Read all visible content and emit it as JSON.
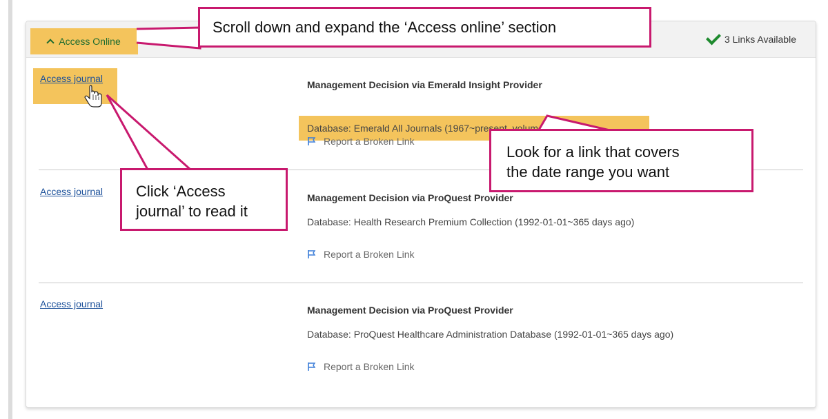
{
  "header": {
    "toggle_label": "Access Online",
    "links_available": "3 Links Available"
  },
  "links": [
    {
      "access_label": "Access journal",
      "provider": "Management Decision via Emerald Insight Provider",
      "database": "Database: Emerald All Journals (1967~present, volume:1;issue:1)",
      "report_label": "Report a Broken Link"
    },
    {
      "access_label": "Access journal",
      "provider": "Management Decision via ProQuest Provider",
      "database": "Database: Health Research Premium Collection (1992-01-01~365 days ago)",
      "report_label": "Report a Broken Link"
    },
    {
      "access_label": "Access journal",
      "provider": "Management Decision via ProQuest Provider",
      "database": "Database: ProQuest Healthcare Administration Database (1992-01-01~365 days ago)",
      "report_label": "Report a Broken Link"
    }
  ],
  "callouts": {
    "scroll": "Scroll down and expand the ‘Access online’ section",
    "click_line1": "Click ‘Access",
    "click_line2": "journal’ to read it",
    "look_line1": "Look for a link that covers",
    "look_line2": "the date range you want"
  },
  "colors": {
    "highlight": "#f4c45c",
    "callout_border": "#c8196e",
    "link": "#1a4f99",
    "check": "#1e8a2e"
  }
}
